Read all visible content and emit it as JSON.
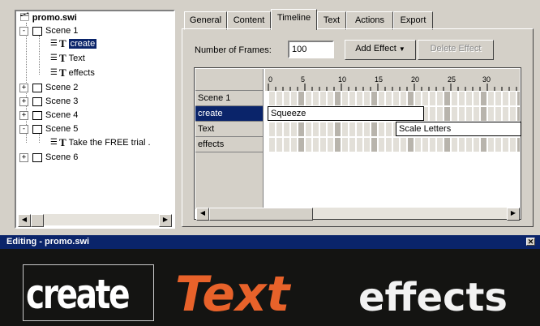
{
  "tree": {
    "root": "promo.swi",
    "items": [
      {
        "label": "Scene 1",
        "expander": "-"
      },
      {
        "label": "create",
        "icon_letter": "T",
        "selected": true
      },
      {
        "label": "Text",
        "icon_letter": "T"
      },
      {
        "label": "effects",
        "icon_letter": "T"
      },
      {
        "label": "Scene 2",
        "expander": "+"
      },
      {
        "label": "Scene 3",
        "expander": "+"
      },
      {
        "label": "Scene 4",
        "expander": "+"
      },
      {
        "label": "Scene 5",
        "expander": "-"
      },
      {
        "label": "Take the FREE trial .",
        "icon_letter": "T"
      },
      {
        "label": "Scene 6",
        "expander": "+"
      }
    ]
  },
  "tabs": [
    "General",
    "Content",
    "Timeline",
    "Text",
    "Actions",
    "Export"
  ],
  "active_tab": "Timeline",
  "frames": {
    "label": "Number of Frames:",
    "value": "100"
  },
  "buttons": {
    "add_effect": "Add Effect",
    "delete_effect": "Delete Effect"
  },
  "timeline": {
    "ruler": [
      "0",
      "5",
      "10",
      "15",
      "20",
      "25",
      "30"
    ],
    "layers": [
      "Scene 1",
      "create",
      "Text",
      "effects"
    ],
    "effects": [
      {
        "layer": "create",
        "label": "Squeeze"
      },
      {
        "layer": "Text",
        "label": "Scale Letters"
      }
    ]
  },
  "editor": {
    "title": "Editing - promo.swi",
    "words": [
      "create",
      "Text",
      "effects"
    ],
    "colors": {
      "create": "#ffffff",
      "Text": "#e8622a",
      "effects": "#f2f2f2",
      "background": "#141412"
    }
  },
  "colors": {
    "selection": "#0a246a",
    "title_bar": "#0a246a"
  }
}
